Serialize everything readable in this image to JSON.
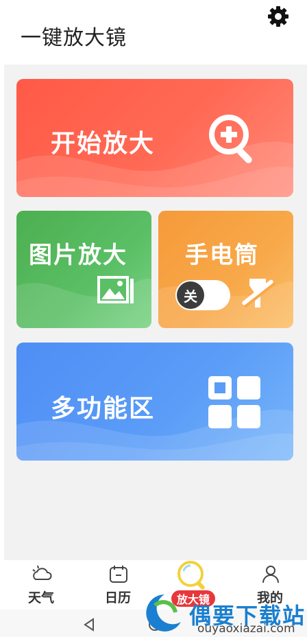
{
  "header": {
    "title": "一键放大镜",
    "settings_icon": "gear-icon"
  },
  "cards": {
    "zoom": {
      "label": "开始放大",
      "icon": "magnifier-plus-icon",
      "color": "#ff5a47"
    },
    "photo": {
      "label": "图片放大",
      "icon": "photo-icon",
      "color": "#4caf50"
    },
    "torch": {
      "label": "手电筒",
      "toggle_label": "关",
      "toggle_state": "off",
      "icon": "flashlight-off-icon",
      "color": "#f59a3a"
    },
    "multi": {
      "label": "多功能区",
      "icon": "grid-icon",
      "color": "#4f8ef5"
    }
  },
  "tabbar": {
    "items": [
      {
        "label": "天气",
        "icon": "weather-icon"
      },
      {
        "label": "日历",
        "icon": "calendar-icon"
      },
      {
        "label": "放大镜",
        "icon": "magnifier-icon",
        "active": true
      },
      {
        "label": "我的",
        "icon": "user-icon"
      }
    ]
  },
  "navbar": {
    "back_icon": "back-triangle-icon",
    "home_icon": "home-circle-icon"
  },
  "watermark": {
    "text": "偶要下载站",
    "url": "ouyaoxiazai.com"
  }
}
